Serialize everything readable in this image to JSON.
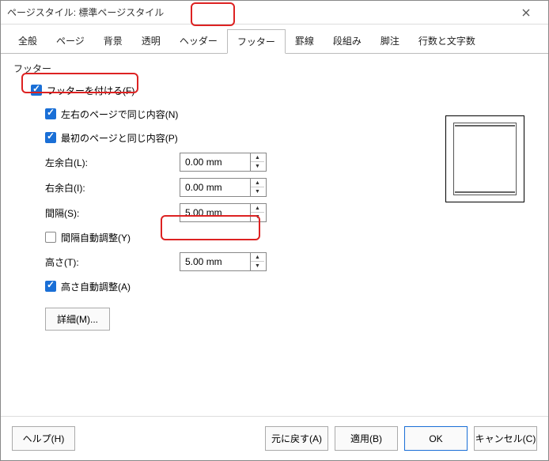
{
  "window": {
    "title": "ページスタイル: 標準ページスタイル"
  },
  "tabs": {
    "items": [
      "全般",
      "ページ",
      "背景",
      "透明",
      "ヘッダー",
      "フッター",
      "罫線",
      "段組み",
      "脚注",
      "行数と文字数"
    ],
    "active": "フッター"
  },
  "section": {
    "title": "フッター"
  },
  "options": {
    "enable": "フッターを付ける(F)",
    "same_lr": "左右のページで同じ内容(N)",
    "same_first": "最初のページと同じ内容(P)",
    "margin_left_lbl": "左余白(L):",
    "margin_left_val": "0.00 mm",
    "margin_right_lbl": "右余白(I):",
    "margin_right_val": "0.00 mm",
    "spacing_lbl": "間隔(S):",
    "spacing_val": "5.00 mm",
    "spacing_auto": "間隔自動調整(Y)",
    "height_lbl": "高さ(T):",
    "height_val": "5.00 mm",
    "height_auto": "高さ自動調整(A)",
    "detail": "詳細(M)..."
  },
  "buttons": {
    "help": "ヘルプ(H)",
    "reset": "元に戻す(A)",
    "apply": "適用(B)",
    "ok": "OK",
    "cancel": "キャンセル(C)"
  }
}
